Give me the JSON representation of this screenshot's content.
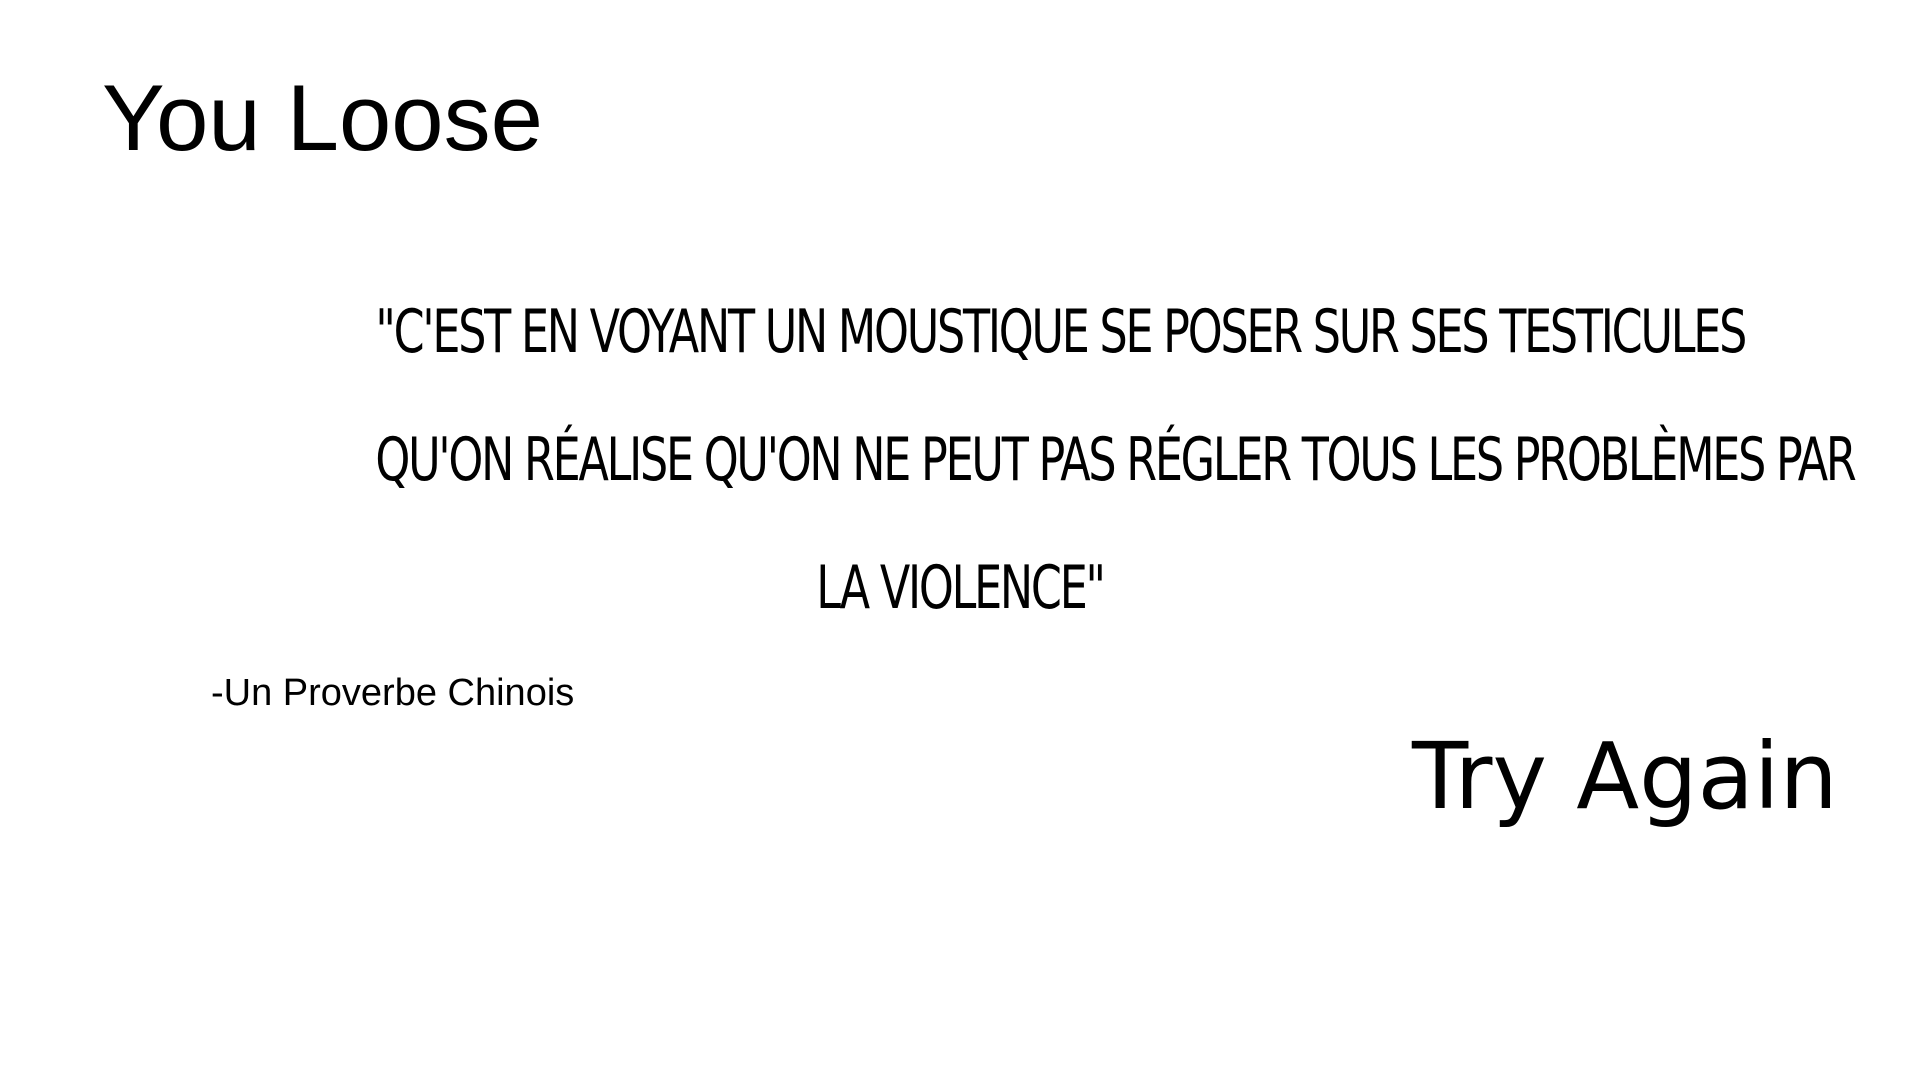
{
  "screen": {
    "title": "You Loose",
    "quote": {
      "lines": [
        "\"C'EST EN VOYANT UN MOUSTIQUE SE POSER SUR SES TESTICULES",
        "QU'ON RÉALISE QU'ON NE PEUT PAS RÉGLER TOUS LES PROBLÈMES PAR",
        "LA VIOLENCE\""
      ],
      "author": "-Un Proverbe Chinois"
    },
    "try_again_label": "Try Again"
  }
}
